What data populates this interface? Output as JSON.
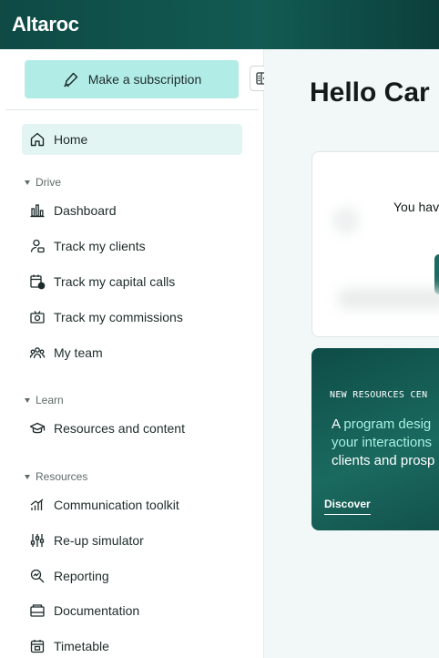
{
  "app": {
    "logo_text": "Altaroc"
  },
  "sidebar": {
    "subscribe_label": "Make a subscription",
    "home": {
      "label": "Home",
      "icon": "home-icon"
    },
    "sections": {
      "drive": {
        "label": "Drive",
        "items": [
          {
            "label": "Dashboard",
            "icon": "bar-chart-icon"
          },
          {
            "label": "Track my clients",
            "icon": "person-icon"
          },
          {
            "label": "Track my capital calls",
            "icon": "calendar-coin-icon"
          },
          {
            "label": "Track my commissions",
            "icon": "money-icon"
          },
          {
            "label": "My team",
            "icon": "team-icon"
          }
        ]
      },
      "learn": {
        "label": "Learn",
        "items": [
          {
            "label": "Resources and content",
            "icon": "graduation-cap-icon"
          }
        ]
      },
      "resources": {
        "label": "Resources",
        "items": [
          {
            "label": "Communication toolkit",
            "icon": "signal-icon"
          },
          {
            "label": "Re-up simulator",
            "icon": "sliders-icon"
          },
          {
            "label": "Reporting",
            "icon": "search-chart-icon"
          },
          {
            "label": "Documentation",
            "icon": "document-icon"
          },
          {
            "label": "Timetable",
            "icon": "calendar-icon"
          }
        ]
      }
    }
  },
  "main": {
    "greeting": "Hello Car",
    "card": {
      "text": "You hav"
    },
    "promo": {
      "title": "NEW RESOURCES CEN",
      "body_prefix": "A ",
      "body_highlight": "program desig",
      "body_line2": "your interactions",
      "body_line3": "clients and prosp",
      "link": "Discover"
    }
  },
  "colors": {
    "topbar": "#0f4a45",
    "accent": "#b2ece6",
    "active_bg": "#e3f5f3",
    "promo_bg": "#125a53"
  }
}
